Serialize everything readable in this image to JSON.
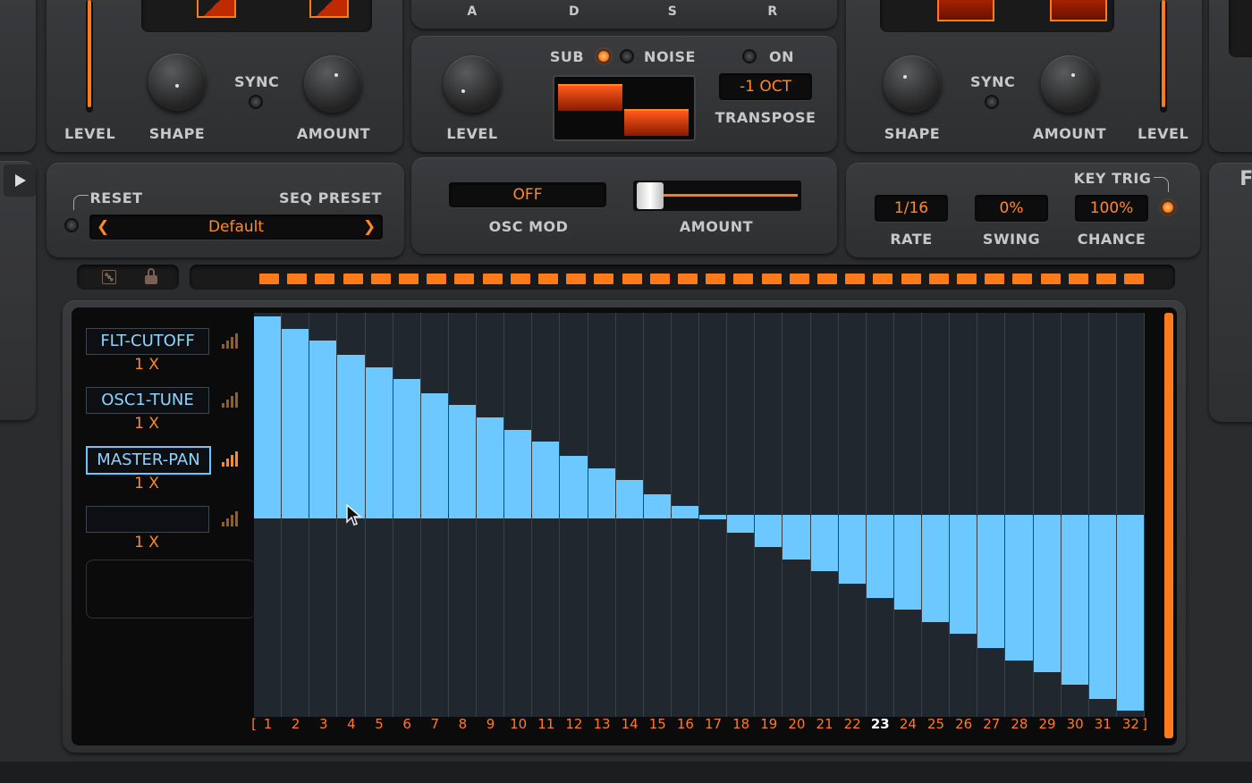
{
  "osc_left": {
    "level_label": "LEVEL",
    "shape_label": "SHAPE",
    "sync_label": "SYNC",
    "amount_label": "AMOUNT"
  },
  "adsr": {
    "a": "A",
    "d": "D",
    "s": "S",
    "r": "R"
  },
  "sub_section": {
    "level_label": "LEVEL",
    "sub_label": "SUB",
    "noise_label": "NOISE",
    "on_label": "ON",
    "transpose_value": "-1 OCT",
    "transpose_label": "TRANSPOSE"
  },
  "osc_right": {
    "shape_label": "SHAPE",
    "sync_label": "SYNC",
    "amount_label": "AMOUNT",
    "level_label": "LEVEL"
  },
  "sequencer_controls": {
    "reset_label": "RESET",
    "seq_preset_label": "SEQ PRESET",
    "preset_value": "Default",
    "prev": "❮",
    "next": "❯",
    "osc_mod_value": "OFF",
    "osc_mod_label": "OSC MOD",
    "amount_label": "AMOUNT",
    "amount_level": 0.05,
    "key_trig_label": "KEY TRIG",
    "rate_value": "1/16",
    "rate_label": "RATE",
    "swing_value": "0%",
    "swing_label": "SWING",
    "chance_value": "100%",
    "chance_label": "CHANCE",
    "right_partial_label": "F"
  },
  "icons": {
    "play": "play-icon",
    "dice": "dice-icon",
    "lock": "lock-icon",
    "cursor": "mouse-pointer-icon"
  },
  "mod_slots": [
    {
      "name": "FLT-CUTOFF",
      "mult": "1 X",
      "active": false
    },
    {
      "name": "OSC1-TUNE",
      "mult": "1 X",
      "active": false
    },
    {
      "name": "MASTER-PAN",
      "mult": "1 X",
      "active": true
    },
    {
      "name": "",
      "mult": "1 X",
      "active": false
    }
  ],
  "colors": {
    "accent": "#ff7a1a",
    "bar": "#6cc8ff",
    "grid": "#20272e"
  },
  "chart_data": {
    "type": "bar",
    "categories": [
      "1",
      "2",
      "3",
      "4",
      "5",
      "6",
      "7",
      "8",
      "9",
      "10",
      "11",
      "12",
      "13",
      "14",
      "15",
      "16",
      "17",
      "18",
      "19",
      "20",
      "21",
      "22",
      "23",
      "24",
      "25",
      "26",
      "27",
      "28",
      "29",
      "30",
      "31",
      "32"
    ],
    "values": [
      1.0,
      0.94,
      0.88,
      0.81,
      0.75,
      0.69,
      0.62,
      0.56,
      0.5,
      0.44,
      0.38,
      0.31,
      0.25,
      0.19,
      0.12,
      0.06,
      -0.02,
      -0.09,
      -0.16,
      -0.22,
      -0.28,
      -0.34,
      -0.41,
      -0.47,
      -0.53,
      -0.59,
      -0.66,
      -0.72,
      -0.78,
      -0.84,
      -0.91,
      -0.97
    ],
    "ylim": [
      -1,
      1
    ],
    "current_step": "23",
    "bracket_left": "[",
    "bracket_right": "]"
  }
}
